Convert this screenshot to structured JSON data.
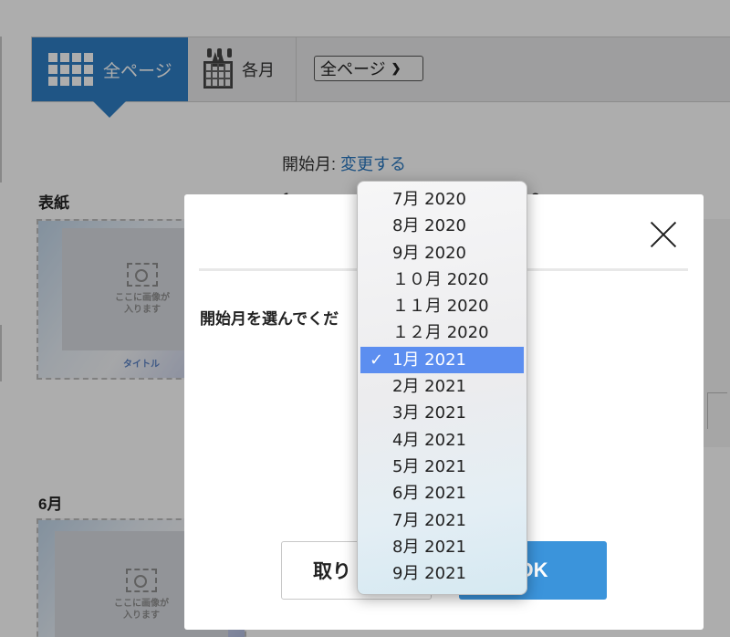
{
  "toolbar": {
    "tab_all_label": "全ページ",
    "tab_month_label": "各月",
    "page_select_value": "全ページ"
  },
  "start_month": {
    "label": "開始月: ",
    "change_link": "変更する"
  },
  "sections": {
    "cover_label": "表紙",
    "june_label": "6月",
    "partial_left": "1",
    "partial_right": "2"
  },
  "thumbnails": {
    "slot_text_line1": "ここに画像が",
    "slot_text_line2": "入ります",
    "cover_title": "タイトル"
  },
  "modal": {
    "prompt": "開始月を選んでくだ",
    "cancel_label": "取り",
    "ok_label": "OK"
  },
  "dropdown": {
    "options": [
      "7月 2020",
      "8月 2020",
      "9月 2020",
      "１０月 2020",
      "１１月 2020",
      "１２月 2020",
      "1月 2021",
      "2月 2021",
      "3月 2021",
      "4月 2021",
      "5月 2021",
      "6月 2021",
      "7月 2021",
      "8月 2021",
      "9月 2021"
    ],
    "selected_index": 6,
    "check_mark": "✓"
  },
  "colors": {
    "accent": "#2f7ec4",
    "ok_button": "#3b94db",
    "selected_option": "#5c8ef0",
    "link": "#2a78c0"
  }
}
